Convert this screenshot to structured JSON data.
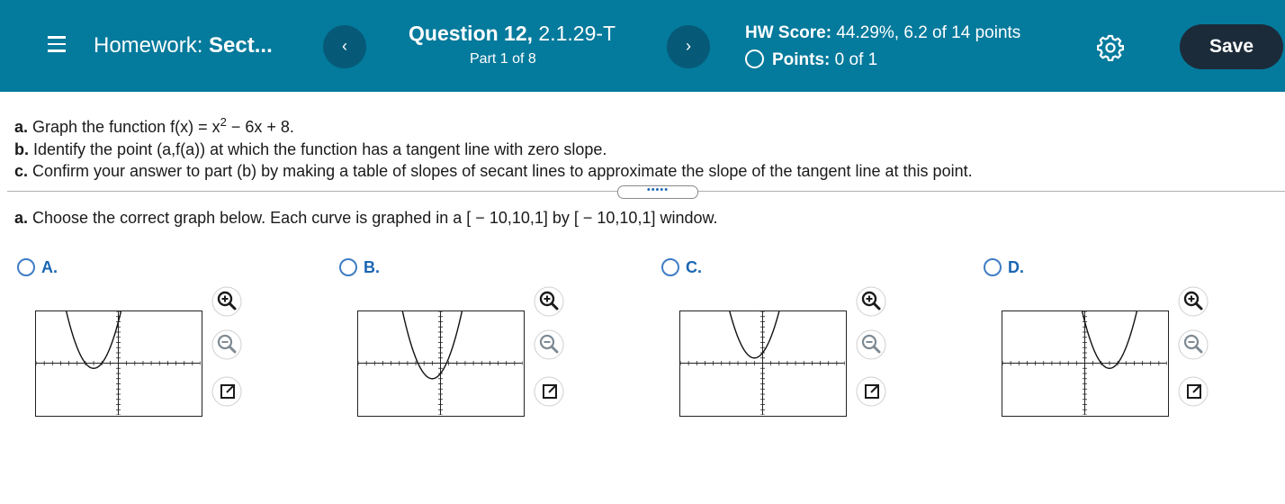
{
  "header": {
    "title_prefix": "Homework: ",
    "title_section": "Sect...",
    "prev_label": "‹",
    "next_label": "›",
    "question_label": "Question 12,",
    "question_id": " 2.1.29-T",
    "part": "Part 1 of 8",
    "hw_score_label": "HW Score:",
    "hw_score_value": " 44.29%, 6.2 of 14 points",
    "points_label": "Points:",
    "points_value": " 0 of 1",
    "save_label": "Save"
  },
  "instructions": {
    "a_label": "a.",
    "a_text_pre": " Graph the function f(x) = x",
    "a_exp": "2",
    "a_text_post": " − 6x + 8.",
    "b_label": "b.",
    "b_text": " Identify the point (a,f(a)) at which the function has a tangent line with zero slope.",
    "c_label": "c.",
    "c_text": " Confirm your answer to part (b) by making a table of slopes of secant lines to approximate the slope of the tangent line at this point."
  },
  "expand_label": "•••••",
  "part_a": {
    "label": "a.",
    "text": " Choose the correct graph below. Each curve is graphed in a [ − 10,10,1] by [ − 10,10,1] window."
  },
  "options": [
    {
      "letter": "A.",
      "function": "(x+3)^2-1"
    },
    {
      "letter": "B.",
      "function": "(x+1)^2-3"
    },
    {
      "letter": "C.",
      "function": "(x+1)^2+1"
    },
    {
      "letter": "D.",
      "function": "(x-3)^2-1"
    }
  ],
  "window": {
    "xmin": -10,
    "xmax": 10,
    "ymin": -10,
    "ymax": 10,
    "step": 1
  },
  "icons": {
    "menu": "hamburger-icon",
    "settings": "gear-icon",
    "zoom_in": "zoom-in-icon",
    "zoom_out": "zoom-out-icon",
    "expand": "open-external-icon"
  },
  "colors": {
    "header": "#047a9c",
    "save_button": "#1c2b3a",
    "option_text": "#1a66b3"
  }
}
